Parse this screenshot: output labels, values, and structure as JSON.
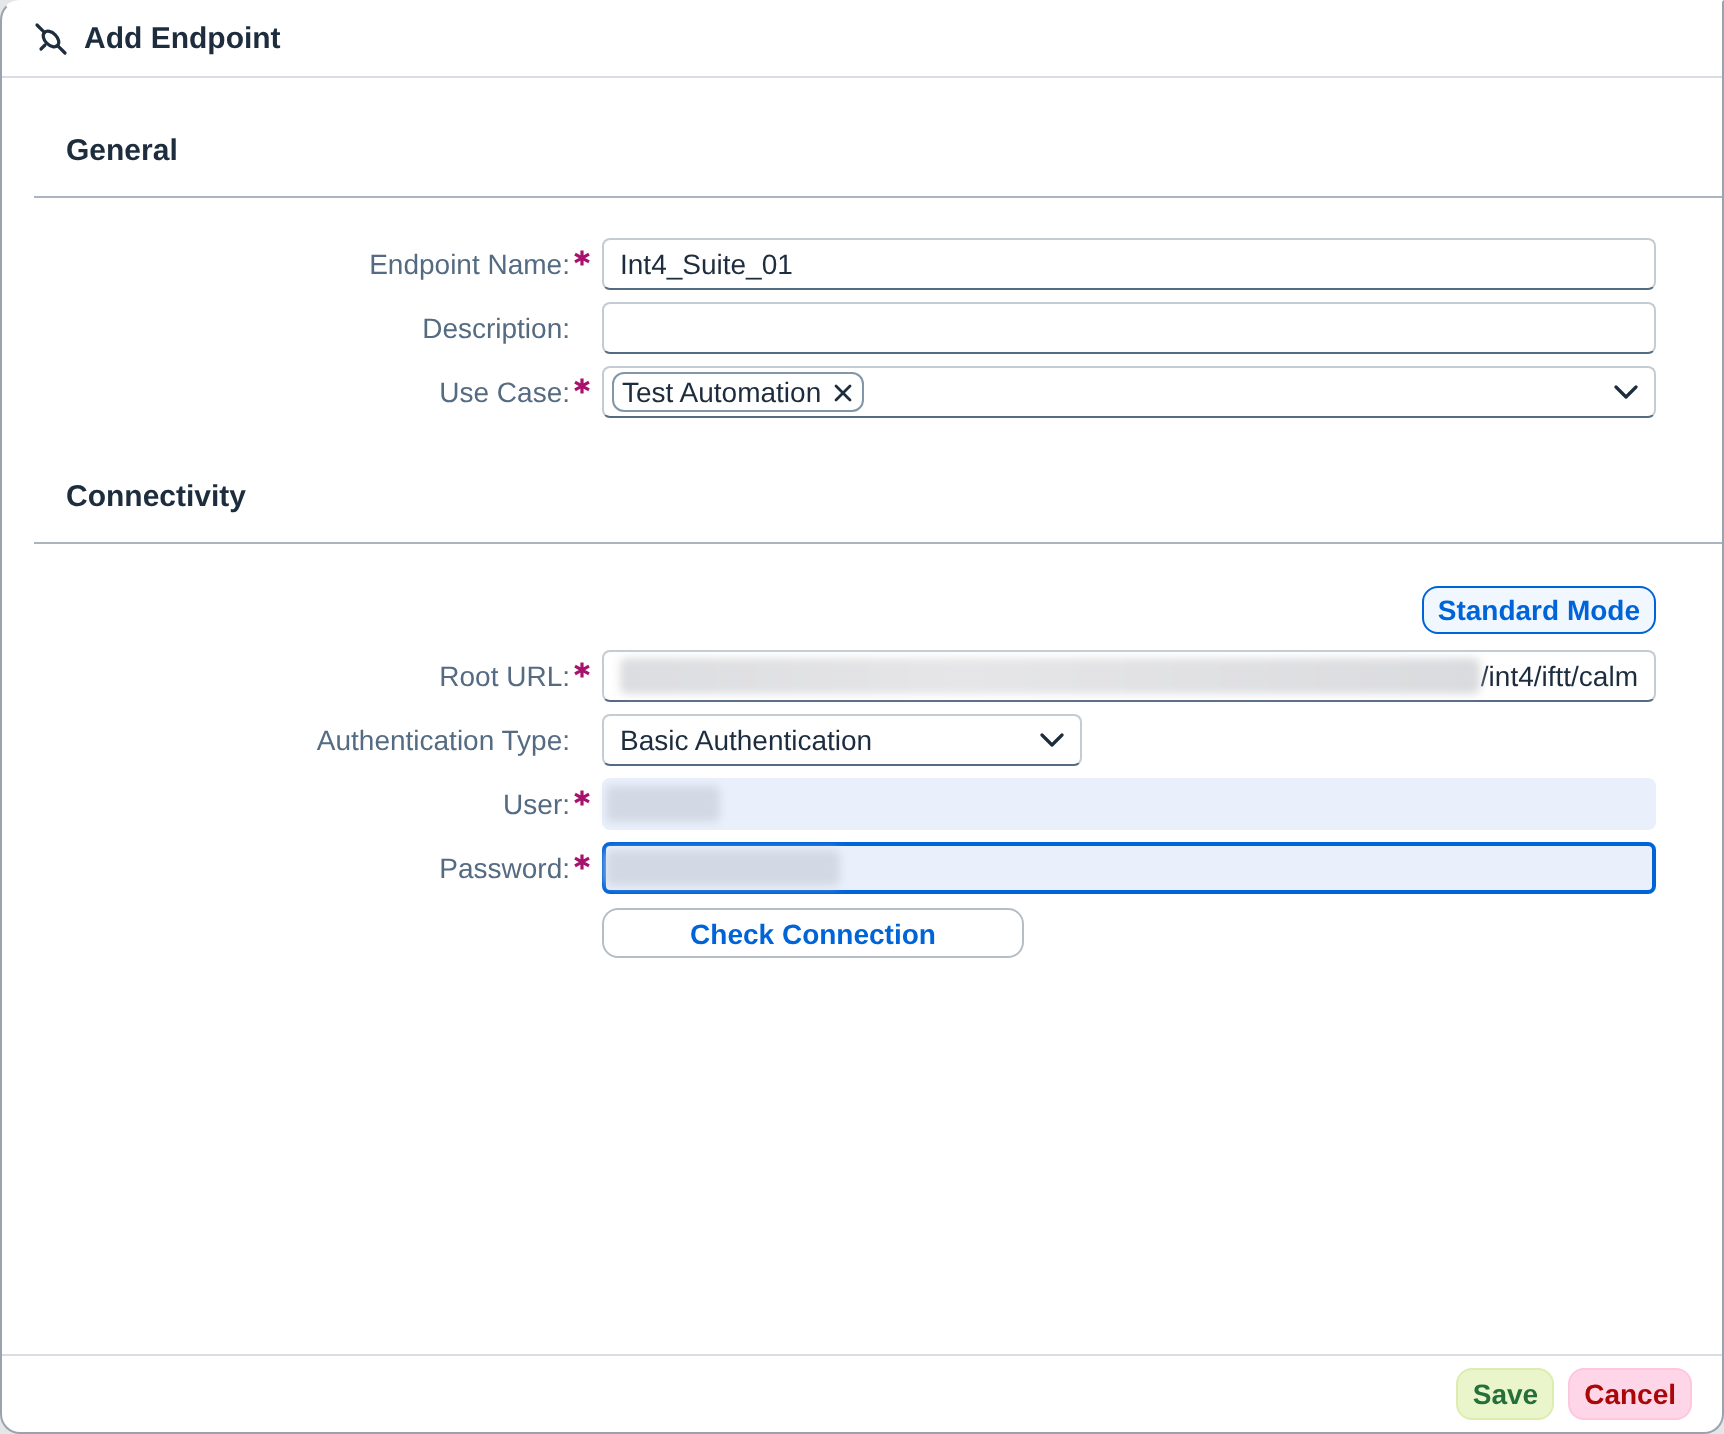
{
  "dialog": {
    "title": "Add Endpoint"
  },
  "sections": [
    {
      "title": "General",
      "fields": [
        {
          "kind": "text",
          "label": "Endpoint Name:",
          "required": true,
          "value": "Int4_Suite_01"
        },
        {
          "kind": "text",
          "label": "Description:",
          "required": false
        },
        {
          "kind": "tokens",
          "label": "Use Case:",
          "required": true,
          "tokens": [
            "Test Automation"
          ]
        }
      ]
    },
    {
      "title": "Connectivity",
      "mode_button": "Standard Mode",
      "fields": [
        {
          "kind": "redacted-text",
          "label": "Root URL:",
          "required": true,
          "value": "/int4/iftt/calm"
        },
        {
          "kind": "select",
          "label": "Authentication Type:",
          "required": false,
          "value": "Basic Authentication"
        },
        {
          "kind": "redacted",
          "label": "User:",
          "required": true,
          "focused": false
        },
        {
          "kind": "redacted",
          "label": "Password:",
          "required": true,
          "focused": true
        }
      ],
      "action_button": "Check Connection"
    }
  ],
  "footer": {
    "buttons": [
      {
        "label": "Save",
        "kind": "accept"
      },
      {
        "label": "Cancel",
        "kind": "reject"
      }
    ]
  }
}
